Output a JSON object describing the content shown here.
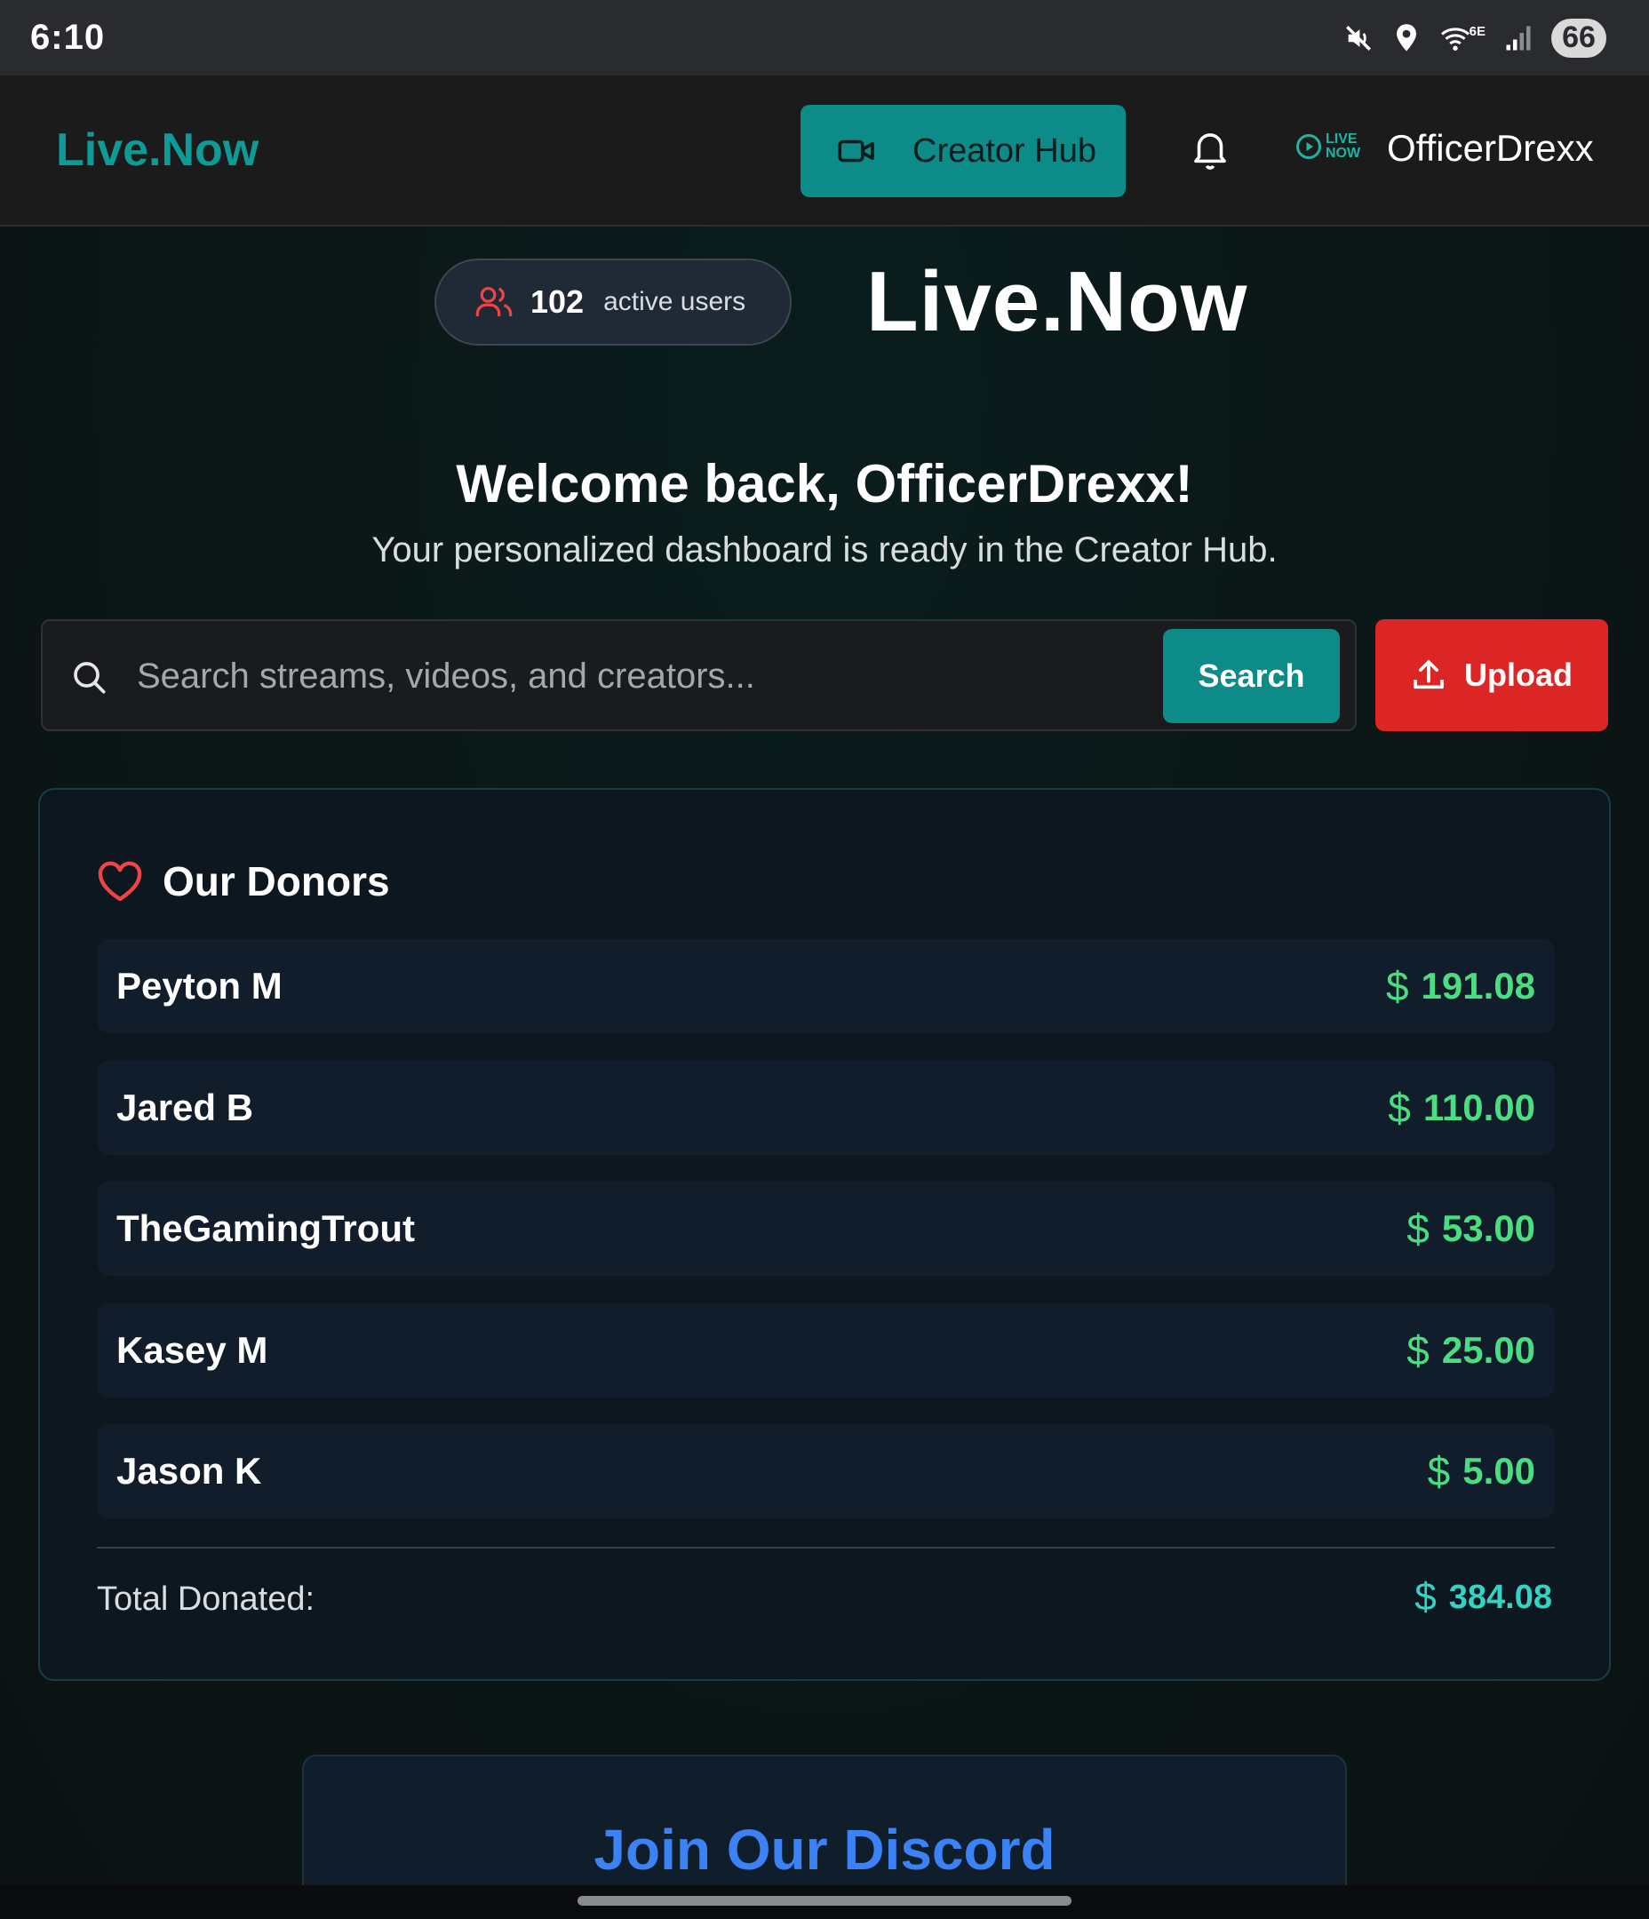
{
  "status_bar": {
    "time": "6:10",
    "network": "6E",
    "battery": "66",
    "icons": [
      "mute-icon",
      "location-icon",
      "wifi-icon",
      "signal-icon",
      "battery-icon"
    ]
  },
  "navbar": {
    "brand": "Live.Now",
    "creator_hub_label": "Creator Hub",
    "username": "OfficerDrexx",
    "live_badge_top": "LIVE",
    "live_badge_bottom": "NOW",
    "accent_color": "#0d8b88"
  },
  "hero": {
    "active_count": "102",
    "active_label": "active users",
    "title": "Live.Now",
    "welcome": "Welcome back, OfficerDrexx!",
    "subtitle": "Your personalized dashboard is ready in the Creator Hub."
  },
  "search": {
    "placeholder": "Search streams, videos, and creators...",
    "value": "",
    "button_label": "Search",
    "upload_label": "Upload"
  },
  "donors": {
    "title": "Our Donors",
    "currency_symbol": "$",
    "items": [
      {
        "name": "Peyton M",
        "amount": "191.08"
      },
      {
        "name": "Jared B",
        "amount": "110.00"
      },
      {
        "name": "TheGamingTrout",
        "amount": "53.00"
      },
      {
        "name": "Kasey M",
        "amount": "25.00"
      },
      {
        "name": "Jason K",
        "amount": "5.00"
      }
    ],
    "total_label": "Total Donated:",
    "total_amount": "384.08",
    "amount_color": "#4ade80",
    "total_color": "#34d3c4"
  },
  "discord": {
    "title": "Join Our Discord",
    "color": "#3b82f6"
  }
}
